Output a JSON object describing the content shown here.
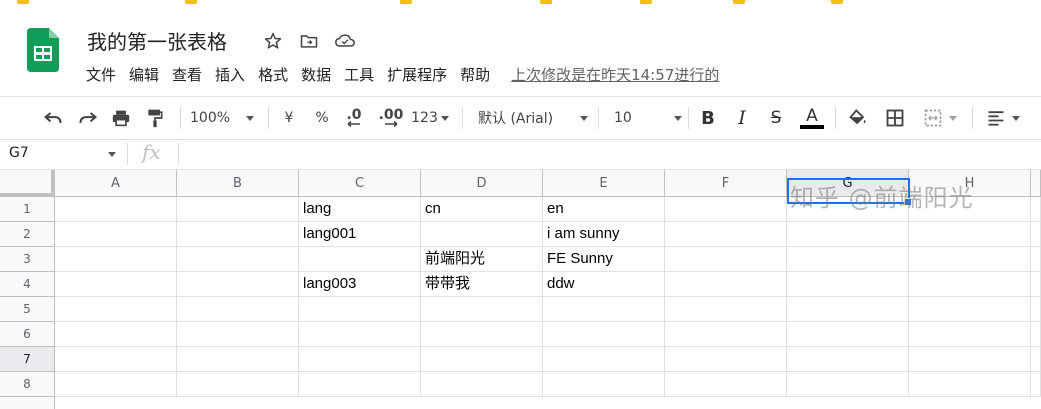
{
  "app": {
    "doc_title": "我的第一张表格",
    "menu": [
      "文件",
      "编辑",
      "查看",
      "插入",
      "格式",
      "数据",
      "工具",
      "扩展程序",
      "帮助"
    ],
    "last_edit": "上次修改是在昨天14:57进行的"
  },
  "toolbar": {
    "zoom": "100%",
    "currency": "¥",
    "percent": "%",
    "decrease_decimal": ".0",
    "increase_decimal": ".00",
    "more_formats": "123",
    "font_family": "默认 (Arial)",
    "font_size": "10",
    "bold": "B",
    "italic": "I",
    "strikethrough": "S",
    "text_color": "A",
    "text_color_value": "#000000"
  },
  "formula_bar": {
    "cell_ref": "G7",
    "fx_label": "fx",
    "value": ""
  },
  "sheet": {
    "columns": [
      "A",
      "B",
      "C",
      "D",
      "E",
      "F",
      "G",
      "H"
    ],
    "rows": [
      "1",
      "2",
      "3",
      "4",
      "5",
      "6",
      "7",
      "8"
    ],
    "cells": {
      "C1": "lang",
      "D1": "cn",
      "E1": "en",
      "C2": "lang001",
      "E2": "i am sunny",
      "D3": "前端阳光",
      "E3": "FE Sunny",
      "C4": "lang003",
      "D4": "带带我",
      "E4": "ddw"
    },
    "active_cell": "G7",
    "selection_color": "#1a73e8"
  },
  "watermark": "知乎 @前端阳光",
  "colors": {
    "sheets_green": "#0f9d58",
    "header_bg": "#f8f9fa",
    "active_header_bg": "#e8eaed"
  }
}
